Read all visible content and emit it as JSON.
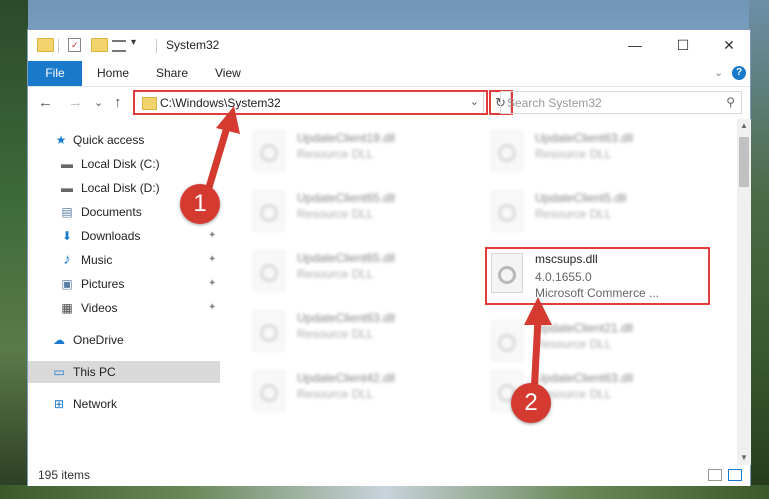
{
  "window": {
    "title": "System32",
    "quick_toolbar_dropdown": "▾",
    "minimize": "—",
    "maximize": "☐",
    "close": "✕"
  },
  "ribbon": {
    "file": "File",
    "tabs": [
      "Home",
      "Share",
      "View"
    ],
    "expand_chevron": "⌄",
    "help": "?"
  },
  "address": {
    "back": "←",
    "forward": "→",
    "recent": "⌄",
    "up": "↑",
    "path": "C:\\Windows\\System32",
    "dropdown": "⌄",
    "refresh": "↻",
    "search_placeholder": "Search System32",
    "search_icon": "⚲"
  },
  "nav": {
    "items": [
      {
        "label": "Quick access",
        "icon": "star-icon",
        "glyph": "★",
        "color": "#1979ca"
      },
      {
        "label": "Local Disk (C:)",
        "icon": "drive-icon",
        "glyph": "▬",
        "color": "#666666"
      },
      {
        "label": "Local Disk (D:)",
        "icon": "drive-icon",
        "glyph": "▬",
        "color": "#666666"
      },
      {
        "label": "Documents",
        "icon": "documents-icon",
        "glyph": "▤",
        "color": "#5b7fa6"
      },
      {
        "label": "Downloads",
        "icon": "download-icon",
        "glyph": "⬇",
        "color": "#1979ca"
      },
      {
        "label": "Music",
        "icon": "music-icon",
        "glyph": "♪",
        "color": "#1979ca"
      },
      {
        "label": "Pictures",
        "icon": "pictures-icon",
        "glyph": "▣",
        "color": "#5b7fa6"
      },
      {
        "label": "Videos",
        "icon": "videos-icon",
        "glyph": "▦",
        "color": "#444444"
      },
      {
        "label": "OneDrive",
        "icon": "cloud-icon",
        "glyph": "☁",
        "color": "#1979ca"
      },
      {
        "label": "This PC",
        "icon": "computer-icon",
        "glyph": "▭",
        "color": "#1979ca"
      },
      {
        "label": "Network",
        "icon": "network-icon",
        "glyph": "⊞",
        "color": "#1979ca"
      }
    ],
    "pin_glyph": "📌"
  },
  "files": {
    "highlighted": {
      "name": "mscsups.dll",
      "version": "4.0.1655.0",
      "company": "Microsoft Commerce ..."
    },
    "blurred": [
      {
        "name": "UpdateClient19.dll",
        "type": "Resource DLL"
      },
      {
        "name": "UpdateClient63.dll",
        "type": "Resource DLL"
      },
      {
        "name": "UpdateClient65.dll",
        "type": "Resource DLL"
      },
      {
        "name": "UpdateClient5.dll",
        "type": "Resource DLL"
      },
      {
        "name": "UpdateClient65.dll",
        "type": "Resource DLL"
      },
      {
        "name": "UpdateClient63.dll",
        "type": "Resource DLL"
      },
      {
        "name": "UpdateClient21.dll",
        "type": "Resource DLL"
      },
      {
        "name": "UpdateClient42.dll",
        "type": "Resource DLL"
      },
      {
        "name": "UpdateClient63.dll",
        "type": "Resource DLL"
      }
    ]
  },
  "status": {
    "count": "195 items"
  },
  "callouts": {
    "one": "1",
    "two": "2",
    "color": "#d43a2f"
  }
}
